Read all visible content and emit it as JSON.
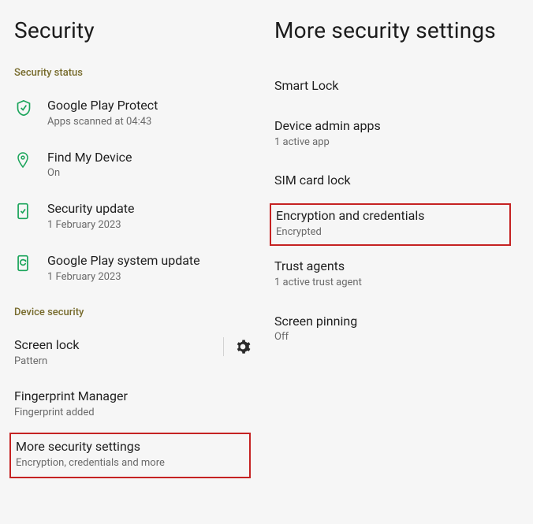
{
  "left": {
    "title": "Security",
    "section1": "Security status",
    "items": [
      {
        "title": "Google Play Protect",
        "sub": "Apps scanned at 04:43"
      },
      {
        "title": "Find My Device",
        "sub": "On"
      },
      {
        "title": "Security update",
        "sub": "1 February 2023"
      },
      {
        "title": "Google Play system update",
        "sub": "1 February 2023"
      }
    ],
    "section2": "Device security",
    "dev": [
      {
        "title": "Screen lock",
        "sub": "Pattern"
      },
      {
        "title": "Fingerprint Manager",
        "sub": "Fingerprint added"
      },
      {
        "title": "More security settings",
        "sub": "Encryption, credentials and more"
      }
    ]
  },
  "right": {
    "title": "More security settings",
    "items": [
      {
        "title": "Smart Lock",
        "sub": ""
      },
      {
        "title": "Device admin apps",
        "sub": "1 active app"
      },
      {
        "title": "SIM card lock",
        "sub": ""
      },
      {
        "title": "Encryption and credentials",
        "sub": "Encrypted"
      },
      {
        "title": "Trust agents",
        "sub": "1 active trust agent"
      },
      {
        "title": "Screen pinning",
        "sub": "Off"
      }
    ]
  }
}
